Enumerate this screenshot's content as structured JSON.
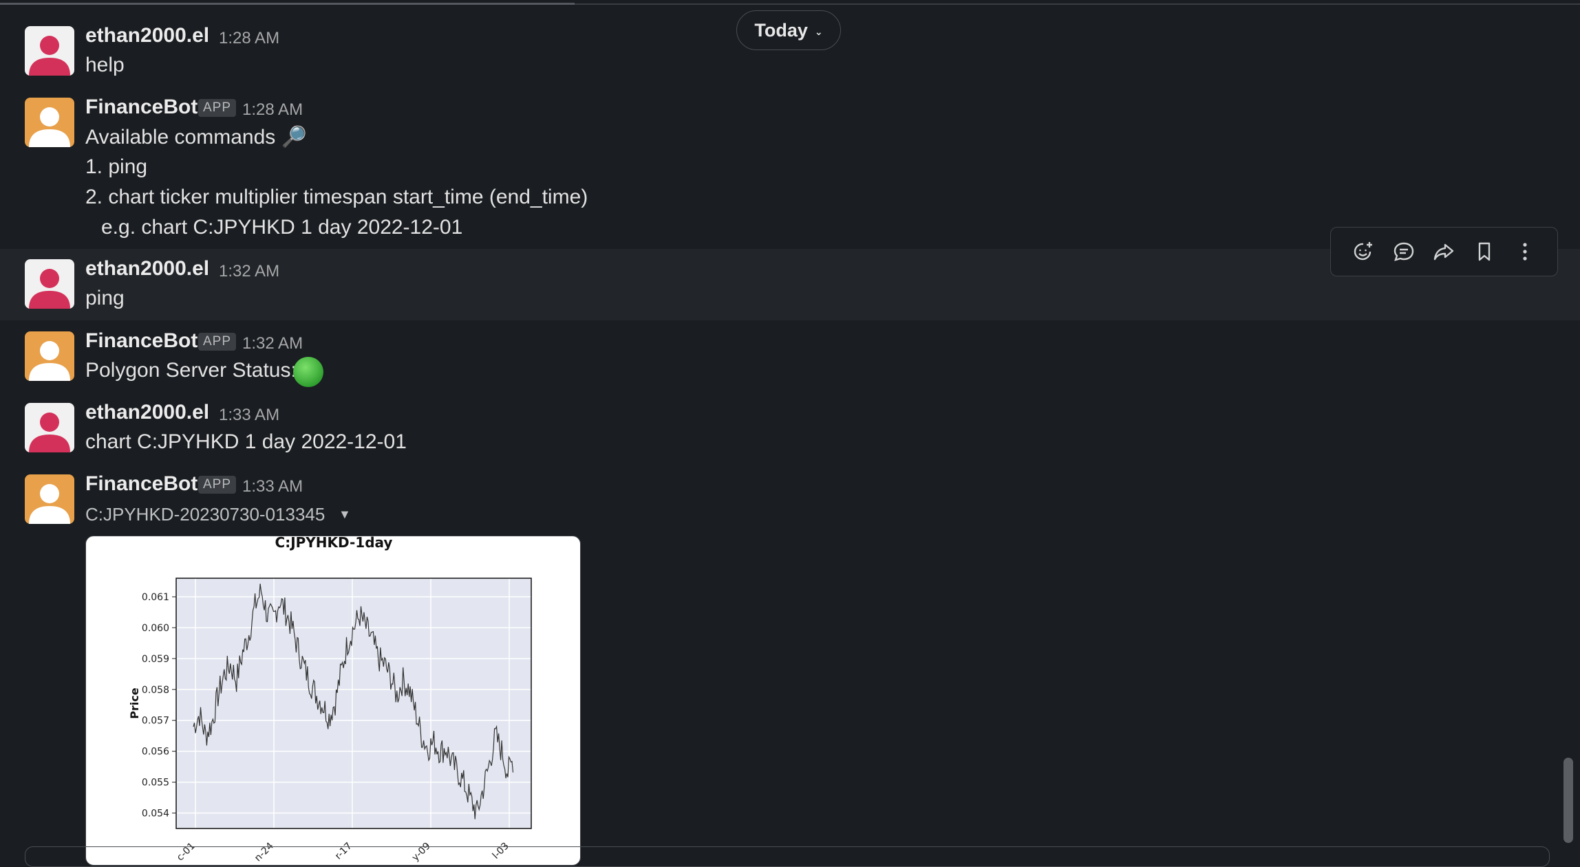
{
  "date_divider": {
    "label": "Today"
  },
  "messages": [
    {
      "author": "ethan2000.el",
      "time": "1:28 AM",
      "is_app": false,
      "lines": [
        "help"
      ]
    },
    {
      "author": "FinanceBot",
      "badge": "APP",
      "time": "1:28 AM",
      "is_app": true,
      "lines": [
        "Available commands 🔎",
        "1. ping",
        "2. chart ticker multiplier timespan start_time (end_time)",
        "e.g. chart C:JPYHKD 1 day 2022-12-01"
      ]
    },
    {
      "author": "ethan2000.el",
      "time": "1:32 AM",
      "is_app": false,
      "lines": [
        "ping"
      ]
    },
    {
      "author": "FinanceBot",
      "badge": "APP",
      "time": "1:32 AM",
      "is_app": true,
      "lines": [
        "Polygon Server Status:"
      ]
    },
    {
      "author": "ethan2000.el",
      "time": "1:33 AM",
      "is_app": false,
      "lines": [
        "chart C:JPYHKD 1 day 2022-12-01"
      ]
    },
    {
      "author": "FinanceBot",
      "badge": "APP",
      "time": "1:33 AM",
      "is_app": true,
      "lines": []
    }
  ],
  "attachment": {
    "file_name": "C:JPYHKD-20230730-013345"
  },
  "action_bar": [
    "add-reaction",
    "reply-in-thread",
    "forward",
    "save",
    "more-actions"
  ],
  "colors": {
    "background": "#1a1d21",
    "hover_row": "#222529",
    "status_green": "#3fbf3f",
    "avatar_red": "#d4315a",
    "avatar_orange": "#e8a04a"
  },
  "chart_data": {
    "type": "line",
    "title": "C:JPYHKD-1day",
    "ylabel": "Price",
    "ylim": [
      0.0535,
      0.0616
    ],
    "yticks": [
      "0.061",
      "0.060",
      "0.059",
      "0.058",
      "0.057",
      "0.056",
      "0.055",
      "0.054"
    ],
    "xticks": [
      "c-01",
      "n-24",
      "r-17",
      "y-09",
      "l-03"
    ],
    "series": [
      {
        "values": [
          0.0568,
          0.0572,
          0.0565,
          0.0569,
          0.0578,
          0.0585,
          0.0588,
          0.0583,
          0.0592,
          0.0598,
          0.0607,
          0.0612,
          0.0604,
          0.0603,
          0.0609,
          0.0605,
          0.06,
          0.0593,
          0.0587,
          0.0582,
          0.0578,
          0.0575,
          0.0571,
          0.0576,
          0.0586,
          0.0595,
          0.06,
          0.0604,
          0.06,
          0.0596,
          0.059,
          0.0588,
          0.0584,
          0.0578,
          0.0583,
          0.058,
          0.0573,
          0.0565,
          0.0561,
          0.0563,
          0.056,
          0.0561,
          0.0556,
          0.0553,
          0.0549,
          0.0544,
          0.054,
          0.0548,
          0.0556,
          0.0565,
          0.056,
          0.0553,
          0.0558
        ]
      }
    ]
  }
}
